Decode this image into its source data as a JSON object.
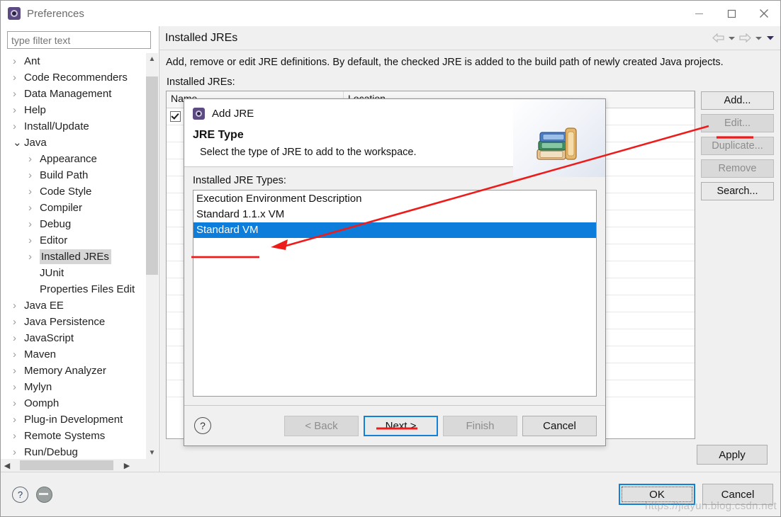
{
  "window": {
    "title": "Preferences",
    "icon": "eclipse-gear-icon",
    "minimize": "minimize-icon",
    "maximize": "maximize-icon",
    "close": "close-icon"
  },
  "filter": {
    "placeholder": "type filter text",
    "value": ""
  },
  "tree": {
    "items": [
      {
        "label": "Ant",
        "indent": 0,
        "expandable": true,
        "expanded": false,
        "selected": false
      },
      {
        "label": "Code Recommenders",
        "indent": 0,
        "expandable": true,
        "expanded": false,
        "selected": false
      },
      {
        "label": "Data Management",
        "indent": 0,
        "expandable": true,
        "expanded": false,
        "selected": false
      },
      {
        "label": "Help",
        "indent": 0,
        "expandable": true,
        "expanded": false,
        "selected": false
      },
      {
        "label": "Install/Update",
        "indent": 0,
        "expandable": true,
        "expanded": false,
        "selected": false
      },
      {
        "label": "Java",
        "indent": 0,
        "expandable": true,
        "expanded": true,
        "selected": false
      },
      {
        "label": "Appearance",
        "indent": 1,
        "expandable": true,
        "expanded": false,
        "selected": false
      },
      {
        "label": "Build Path",
        "indent": 1,
        "expandable": true,
        "expanded": false,
        "selected": false
      },
      {
        "label": "Code Style",
        "indent": 1,
        "expandable": true,
        "expanded": false,
        "selected": false
      },
      {
        "label": "Compiler",
        "indent": 1,
        "expandable": true,
        "expanded": false,
        "selected": false
      },
      {
        "label": "Debug",
        "indent": 1,
        "expandable": true,
        "expanded": false,
        "selected": false
      },
      {
        "label": "Editor",
        "indent": 1,
        "expandable": true,
        "expanded": false,
        "selected": false
      },
      {
        "label": "Installed JREs",
        "indent": 1,
        "expandable": true,
        "expanded": false,
        "selected": true
      },
      {
        "label": "JUnit",
        "indent": 1,
        "expandable": false,
        "expanded": false,
        "selected": false
      },
      {
        "label": "Properties Files Edit",
        "indent": 1,
        "expandable": false,
        "expanded": false,
        "selected": false
      },
      {
        "label": "Java EE",
        "indent": 0,
        "expandable": true,
        "expanded": false,
        "selected": false
      },
      {
        "label": "Java Persistence",
        "indent": 0,
        "expandable": true,
        "expanded": false,
        "selected": false
      },
      {
        "label": "JavaScript",
        "indent": 0,
        "expandable": true,
        "expanded": false,
        "selected": false
      },
      {
        "label": "Maven",
        "indent": 0,
        "expandable": true,
        "expanded": false,
        "selected": false
      },
      {
        "label": "Memory Analyzer",
        "indent": 0,
        "expandable": true,
        "expanded": false,
        "selected": false
      },
      {
        "label": "Mylyn",
        "indent": 0,
        "expandable": true,
        "expanded": false,
        "selected": false
      },
      {
        "label": "Oomph",
        "indent": 0,
        "expandable": true,
        "expanded": false,
        "selected": false
      },
      {
        "label": "Plug-in Development",
        "indent": 0,
        "expandable": true,
        "expanded": false,
        "selected": false
      },
      {
        "label": "Remote Systems",
        "indent": 0,
        "expandable": true,
        "expanded": false,
        "selected": false
      },
      {
        "label": "Run/Debug",
        "indent": 0,
        "expandable": true,
        "expanded": false,
        "selected": false
      }
    ]
  },
  "page": {
    "title": "Installed JREs",
    "description": "Add, remove or edit JRE definitions. By default, the checked JRE is added to the build path of newly created Java projects.",
    "section_label": "Installed JREs:",
    "columns": [
      "Name",
      "Location"
    ],
    "nav": {
      "back": "back-arrow-icon",
      "back_menu": "chevron-down-icon",
      "forward": "forward-arrow-icon",
      "forward_menu": "chevron-down-icon",
      "view_menu": "view-menu-chevron-icon"
    },
    "buttons": [
      {
        "label": "Add...",
        "enabled": true
      },
      {
        "label": "Edit...",
        "enabled": false
      },
      {
        "label": "Duplicate...",
        "enabled": false
      },
      {
        "label": "Remove",
        "enabled": false
      },
      {
        "label": "Search...",
        "enabled": true
      }
    ],
    "apply_label": "Apply"
  },
  "bottom": {
    "help_icon": "help-question-icon",
    "restore_icon": "restore-defaults-icon",
    "ok_label": "OK",
    "cancel_label": "Cancel"
  },
  "dialog": {
    "title": "Add JRE",
    "icon": "eclipse-gear-icon",
    "minimize": "minimize-icon",
    "maximize": "maximize-icon",
    "close": "close-icon",
    "heading": "JRE Type",
    "subtext": "Select the type of JRE to add to the workspace.",
    "banner_icon": "books-stack-icon",
    "list_label": "Installed JRE Types:",
    "types": [
      {
        "label": "Execution Environment Description",
        "selected": false
      },
      {
        "label": "Standard 1.1.x VM",
        "selected": false
      },
      {
        "label": "Standard VM",
        "selected": true
      }
    ],
    "help_icon": "help-question-icon",
    "buttons": [
      {
        "label": "< Back",
        "enabled": false,
        "focused": false
      },
      {
        "label": "Next >",
        "enabled": true,
        "focused": true
      },
      {
        "label": "Finish",
        "enabled": false,
        "focused": false
      },
      {
        "label": "Cancel",
        "enabled": true,
        "focused": false
      }
    ]
  },
  "annotation": {
    "accent_color": "#ee1b1b",
    "arrow_target": "Standard VM",
    "underlined_items": [
      "Standard VM",
      "Next >",
      "Add..."
    ]
  },
  "watermark": {
    "text": "https://jiayun.blog.csdn.net"
  }
}
